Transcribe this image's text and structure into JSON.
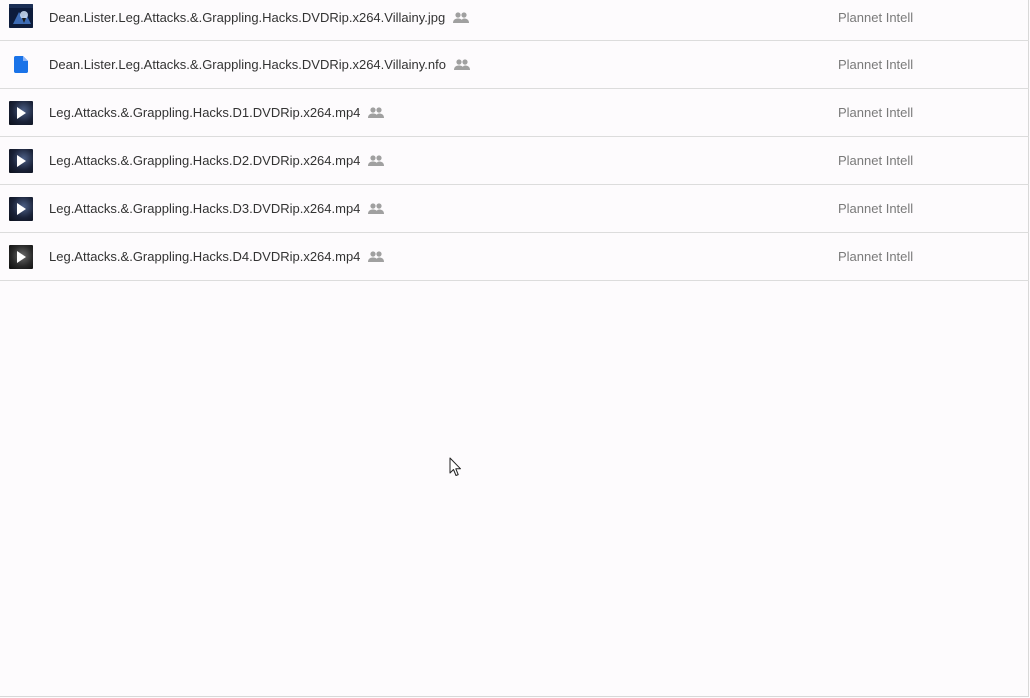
{
  "files": [
    {
      "name": "Dean.Lister.Leg.Attacks.&.Grappling.Hacks.DVDRip.x264.Villainy.jpg",
      "type_icon": "image-thumbnail-icon",
      "shared_icon": "people-icon",
      "owner": "Plannet Intell"
    },
    {
      "name": "Dean.Lister.Leg.Attacks.&.Grappling.Hacks.DVDRip.x264.Villainy.nfo",
      "type_icon": "document-icon",
      "shared_icon": "people-icon",
      "owner": "Plannet Intell"
    },
    {
      "name": "Leg.Attacks.&.Grappling.Hacks.D1.DVDRip.x264.mp4",
      "type_icon": "video-thumbnail-icon",
      "shared_icon": "people-icon",
      "owner": "Plannet Intell"
    },
    {
      "name": "Leg.Attacks.&.Grappling.Hacks.D2.DVDRip.x264.mp4",
      "type_icon": "video-thumbnail-icon",
      "shared_icon": "people-icon",
      "owner": "Plannet Intell"
    },
    {
      "name": "Leg.Attacks.&.Grappling.Hacks.D3.DVDRip.x264.mp4",
      "type_icon": "video-thumbnail-icon",
      "shared_icon": "people-icon",
      "owner": "Plannet Intell"
    },
    {
      "name": "Leg.Attacks.&.Grappling.Hacks.D4.DVDRip.x264.mp4",
      "type_icon": "video-thumbnail-icon",
      "shared_icon": "people-icon",
      "owner": "Plannet Intell"
    }
  ],
  "colors": {
    "document_icon": "#1a73e8",
    "shared_icon": "#9e9e9e",
    "row_divider": "#dcdcdc",
    "background": "#fdfbfd"
  },
  "cursor_icon": "mouse-pointer-icon"
}
